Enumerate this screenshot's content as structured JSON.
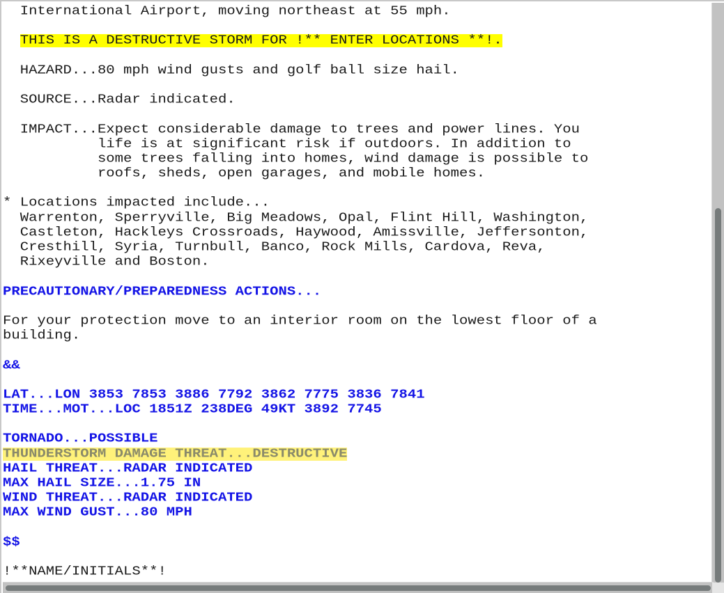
{
  "document": {
    "lines": [
      {
        "text": "  International Airport, moving northeast at 55 mph.",
        "style": "normal"
      },
      {
        "text": "",
        "style": "normal"
      },
      {
        "prefix": "  ",
        "text": "THIS IS A DESTRUCTIVE STORM FOR !** ENTER LOCATIONS **!.",
        "style": "highlight-yellow"
      },
      {
        "text": "",
        "style": "normal"
      },
      {
        "text": "  HAZARD...80 mph wind gusts and golf ball size hail.",
        "style": "normal"
      },
      {
        "text": "",
        "style": "normal"
      },
      {
        "text": "  SOURCE...Radar indicated.",
        "style": "normal"
      },
      {
        "text": "",
        "style": "normal"
      },
      {
        "text": "  IMPACT...Expect considerable damage to trees and power lines. You",
        "style": "normal"
      },
      {
        "text": "           life is at significant risk if outdoors. In addition to",
        "style": "normal"
      },
      {
        "text": "           some trees falling into homes, wind damage is possible to",
        "style": "normal"
      },
      {
        "text": "           roofs, sheds, open garages, and mobile homes.",
        "style": "normal"
      },
      {
        "text": "",
        "style": "normal"
      },
      {
        "text": "* Locations impacted include...",
        "style": "normal"
      },
      {
        "text": "  Warrenton, Sperryville, Big Meadows, Opal, Flint Hill, Washington,",
        "style": "normal"
      },
      {
        "text": "  Castleton, Hackleys Crossroads, Haywood, Amissville, Jeffersonton,",
        "style": "normal"
      },
      {
        "text": "  Cresthill, Syria, Turnbull, Banco, Rock Mills, Cardova, Reva,",
        "style": "normal"
      },
      {
        "text": "  Rixeyville and Boston.",
        "style": "normal"
      },
      {
        "text": "",
        "style": "normal"
      },
      {
        "text": "PRECAUTIONARY/PREPAREDNESS ACTIONS...",
        "style": "blue-bold"
      },
      {
        "text": "",
        "style": "normal"
      },
      {
        "text": "For your protection move to an interior room on the lowest floor of a",
        "style": "normal"
      },
      {
        "text": "building.",
        "style": "normal"
      },
      {
        "text": "",
        "style": "normal"
      },
      {
        "text": "&&",
        "style": "blue-bold"
      },
      {
        "text": "",
        "style": "normal"
      },
      {
        "text": "LAT...LON 3853 7853 3886 7792 3862 7775 3836 7841",
        "style": "blue-bold"
      },
      {
        "text": "TIME...MOT...LOC 1851Z 238DEG 49KT 3892 7745",
        "style": "blue-bold"
      },
      {
        "text": "",
        "style": "normal"
      },
      {
        "text": "TORNADO...POSSIBLE",
        "style": "blue-bold"
      },
      {
        "text": "THUNDERSTORM DAMAGE THREAT...DESTRUCTIVE",
        "style": "highlight-pale"
      },
      {
        "text": "HAIL THREAT...RADAR INDICATED",
        "style": "blue-bold"
      },
      {
        "text": "MAX HAIL SIZE...1.75 IN",
        "style": "blue-bold"
      },
      {
        "text": "WIND THREAT...RADAR INDICATED",
        "style": "blue-bold"
      },
      {
        "text": "MAX WIND GUST...80 MPH",
        "style": "blue-bold"
      },
      {
        "text": "",
        "style": "normal"
      },
      {
        "text": "$$",
        "style": "blue-bold"
      },
      {
        "text": "",
        "style": "normal"
      },
      {
        "text": "!**NAME/INITIALS**!",
        "style": "normal"
      }
    ]
  },
  "colors": {
    "keyword_blue": "#1414e6",
    "highlight_yellow": "#ffff00",
    "highlight_pale": "#fff27a",
    "scrollbar_track": "#c2c2c2",
    "scrollbar_thumb": "#767b7b"
  },
  "scroll": {
    "vertical_position_fraction": 1.0,
    "horizontal_position_fraction": 0.0
  }
}
